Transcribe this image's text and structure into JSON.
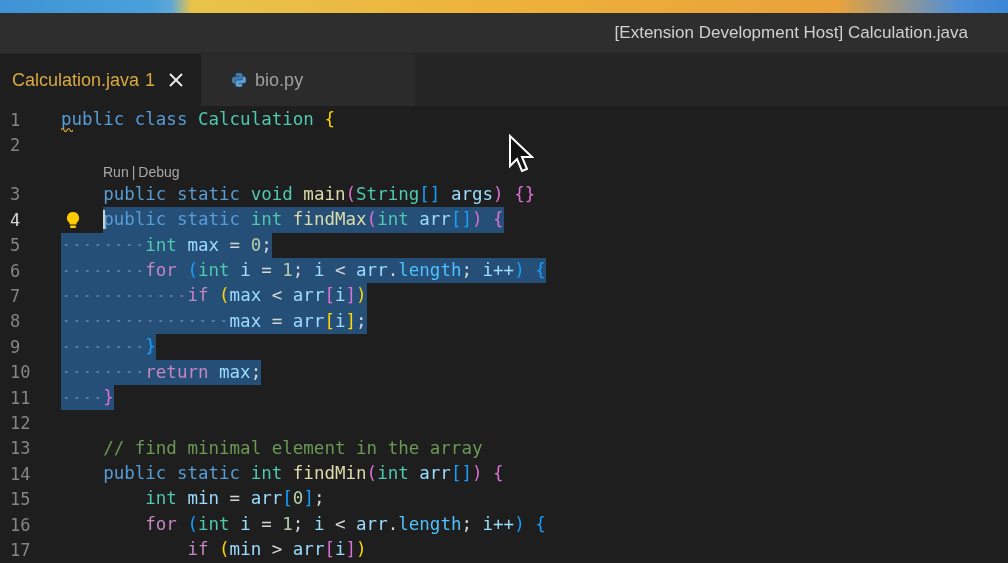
{
  "window": {
    "title": "[Extension Development Host] Calculation.java"
  },
  "tabs": [
    {
      "label": "Calculation.java",
      "kind": "java",
      "problems": "1",
      "selected": true,
      "modified_warning": true
    },
    {
      "label": "bio.py",
      "kind": "python",
      "selected": false,
      "modified_warning": false
    }
  ],
  "editor": {
    "lines": [
      {
        "kind": "code",
        "number": "1",
        "squiggle": true,
        "selected": false,
        "cursor": false,
        "lightbulb": false,
        "tokens": [
          {
            "text": "public",
            "kind": "keyword"
          },
          {
            "text": " class",
            "kind": "keyword"
          },
          {
            "text": " Calculation",
            "kind": "type"
          },
          {
            "text": " {",
            "kind": "bracket1"
          }
        ]
      },
      {
        "kind": "code",
        "number": "2",
        "cursor": false,
        "lightbulb": false
      },
      {
        "kind": "codelens",
        "links": [
          "Run",
          "Debug"
        ],
        "separator": "|"
      },
      {
        "kind": "code",
        "number": "3",
        "squiggle": false,
        "selected": false,
        "cursor": false,
        "lightbulb": false,
        "tokens": [
          {
            "text": "    public",
            "kind": "keyword"
          },
          {
            "text": " static",
            "kind": "keyword"
          },
          {
            "text": " void",
            "kind": "type"
          },
          {
            "text": " main",
            "kind": "function"
          },
          {
            "text": "(",
            "kind": "bracket2"
          },
          {
            "text": "String",
            "kind": "type"
          },
          {
            "text": "[]",
            "kind": "bracket3"
          },
          {
            "text": " args",
            "kind": "variable"
          },
          {
            "text": ")",
            "kind": "bracket2"
          },
          {
            "text": " {}",
            "kind": "bracket2"
          }
        ]
      },
      {
        "kind": "code",
        "number": "4",
        "squiggle": false,
        "selected": true,
        "cursor": true,
        "lightbulb": true,
        "tokens": [
          {
            "text": "    public",
            "kind": "keyword"
          },
          {
            "text": " static",
            "kind": "keyword"
          },
          {
            "text": " int",
            "kind": "type"
          },
          {
            "text": " findMax",
            "kind": "function"
          },
          {
            "text": "(",
            "kind": "bracket2"
          },
          {
            "text": "int",
            "kind": "type"
          },
          {
            "text": " arr",
            "kind": "variable"
          },
          {
            "text": "[]",
            "kind": "bracket3"
          },
          {
            "text": ")",
            "kind": "bracket2"
          },
          {
            "text": " {",
            "kind": "bracket2"
          }
        ]
      },
      {
        "kind": "code",
        "number": "5",
        "squiggle": false,
        "selected": true,
        "cursor": false,
        "lightbulb": false,
        "tokens": [
          {
            "text": "        int",
            "kind": "type"
          },
          {
            "text": " max",
            "kind": "variable"
          },
          {
            "text": " =",
            "kind": "operator"
          },
          {
            "text": " 0",
            "kind": "number"
          },
          {
            "text": ";",
            "kind": "operator"
          }
        ]
      },
      {
        "kind": "code",
        "number": "6",
        "squiggle": false,
        "selected": true,
        "cursor": false,
        "lightbulb": false,
        "tokens": [
          {
            "text": "        for",
            "kind": "control"
          },
          {
            "text": " (",
            "kind": "bracket3"
          },
          {
            "text": "int",
            "kind": "type"
          },
          {
            "text": " i",
            "kind": "variable"
          },
          {
            "text": " =",
            "kind": "operator"
          },
          {
            "text": " 1",
            "kind": "number"
          },
          {
            "text": ";",
            "kind": "operator"
          },
          {
            "text": " i",
            "kind": "variable"
          },
          {
            "text": " <",
            "kind": "operator"
          },
          {
            "text": " arr",
            "kind": "variable"
          },
          {
            "text": ".",
            "kind": "operator"
          },
          {
            "text": "length",
            "kind": "property"
          },
          {
            "text": ";",
            "kind": "operator"
          },
          {
            "text": " i++",
            "kind": "variable"
          },
          {
            "text": ")",
            "kind": "bracket3"
          },
          {
            "text": " {",
            "kind": "bracket3"
          }
        ]
      },
      {
        "kind": "code",
        "number": "7",
        "squiggle": false,
        "selected": true,
        "cursor": false,
        "lightbulb": false,
        "tokens": [
          {
            "text": "            if",
            "kind": "control"
          },
          {
            "text": " (",
            "kind": "bracket1"
          },
          {
            "text": "max",
            "kind": "variable"
          },
          {
            "text": " <",
            "kind": "operator"
          },
          {
            "text": " arr",
            "kind": "variable"
          },
          {
            "text": "[",
            "kind": "bracket2"
          },
          {
            "text": "i",
            "kind": "variable"
          },
          {
            "text": "]",
            "kind": "bracket2"
          },
          {
            "text": ")",
            "kind": "bracket1"
          }
        ]
      },
      {
        "kind": "code",
        "number": "8",
        "squiggle": false,
        "selected": true,
        "cursor": false,
        "lightbulb": false,
        "tokens": [
          {
            "text": "                max",
            "kind": "variable"
          },
          {
            "text": " =",
            "kind": "operator"
          },
          {
            "text": " arr",
            "kind": "variable"
          },
          {
            "text": "[",
            "kind": "bracket1"
          },
          {
            "text": "i",
            "kind": "variable"
          },
          {
            "text": "]",
            "kind": "bracket1"
          },
          {
            "text": ";",
            "kind": "operator"
          }
        ]
      },
      {
        "kind": "code",
        "number": "9",
        "squiggle": false,
        "selected": true,
        "cursor": false,
        "lightbulb": false,
        "tokens": [
          {
            "text": "        }",
            "kind": "bracket3"
          }
        ]
      },
      {
        "kind": "code",
        "number": "10",
        "squiggle": false,
        "selected": true,
        "cursor": false,
        "lightbulb": false,
        "tokens": [
          {
            "text": "        return",
            "kind": "control"
          },
          {
            "text": " max",
            "kind": "variable"
          },
          {
            "text": ";",
            "kind": "operator"
          }
        ]
      },
      {
        "kind": "code",
        "number": "11",
        "squiggle": false,
        "selected": true,
        "cursor": false,
        "lightbulb": false,
        "tokens": [
          {
            "text": "    }",
            "kind": "bracket2"
          }
        ]
      },
      {
        "kind": "code",
        "number": "12",
        "cursor": false,
        "lightbulb": false
      },
      {
        "kind": "code",
        "number": "13",
        "squiggle": false,
        "selected": false,
        "cursor": false,
        "lightbulb": false,
        "tokens": [
          {
            "text": "    // find minimal element in the array",
            "kind": "comment"
          }
        ]
      },
      {
        "kind": "code",
        "number": "14",
        "squiggle": false,
        "selected": false,
        "cursor": false,
        "lightbulb": false,
        "tokens": [
          {
            "text": "    public",
            "kind": "keyword"
          },
          {
            "text": " static",
            "kind": "keyword"
          },
          {
            "text": " int",
            "kind": "type"
          },
          {
            "text": " findMin",
            "kind": "function"
          },
          {
            "text": "(",
            "kind": "bracket2"
          },
          {
            "text": "int",
            "kind": "type"
          },
          {
            "text": " arr",
            "kind": "variable"
          },
          {
            "text": "[]",
            "kind": "bracket3"
          },
          {
            "text": ")",
            "kind": "bracket2"
          },
          {
            "text": " {",
            "kind": "bracket2"
          }
        ]
      },
      {
        "kind": "code",
        "number": "15",
        "squiggle": false,
        "selected": false,
        "cursor": false,
        "lightbulb": false,
        "tokens": [
          {
            "text": "        int",
            "kind": "type"
          },
          {
            "text": " min",
            "kind": "variable"
          },
          {
            "text": " =",
            "kind": "operator"
          },
          {
            "text": " arr",
            "kind": "variable"
          },
          {
            "text": "[",
            "kind": "bracket3"
          },
          {
            "text": "0",
            "kind": "number"
          },
          {
            "text": "]",
            "kind": "bracket3"
          },
          {
            "text": ";",
            "kind": "operator"
          }
        ]
      },
      {
        "kind": "code",
        "number": "16",
        "squiggle": false,
        "selected": false,
        "cursor": false,
        "lightbulb": false,
        "tokens": [
          {
            "text": "        for",
            "kind": "control"
          },
          {
            "text": " (",
            "kind": "bracket3"
          },
          {
            "text": "int",
            "kind": "type"
          },
          {
            "text": " i",
            "kind": "variable"
          },
          {
            "text": " =",
            "kind": "operator"
          },
          {
            "text": " 1",
            "kind": "number"
          },
          {
            "text": ";",
            "kind": "operator"
          },
          {
            "text": " i",
            "kind": "variable"
          },
          {
            "text": " <",
            "kind": "operator"
          },
          {
            "text": " arr",
            "kind": "variable"
          },
          {
            "text": ".",
            "kind": "operator"
          },
          {
            "text": "length",
            "kind": "property"
          },
          {
            "text": ";",
            "kind": "operator"
          },
          {
            "text": " i++",
            "kind": "variable"
          },
          {
            "text": ")",
            "kind": "bracket3"
          },
          {
            "text": " {",
            "kind": "bracket3"
          }
        ]
      },
      {
        "kind": "code",
        "number": "17",
        "squiggle": false,
        "selected": false,
        "cursor": false,
        "lightbulb": false,
        "tokens": [
          {
            "text": "            if",
            "kind": "control"
          },
          {
            "text": " (",
            "kind": "bracket1"
          },
          {
            "text": "min",
            "kind": "variable"
          },
          {
            "text": " >",
            "kind": "operator"
          },
          {
            "text": " arr",
            "kind": "variable"
          },
          {
            "text": "[",
            "kind": "bracket2"
          },
          {
            "text": "i",
            "kind": "variable"
          },
          {
            "text": "]",
            "kind": "bracket2"
          },
          {
            "text": ")",
            "kind": "bracket1"
          }
        ]
      }
    ]
  }
}
